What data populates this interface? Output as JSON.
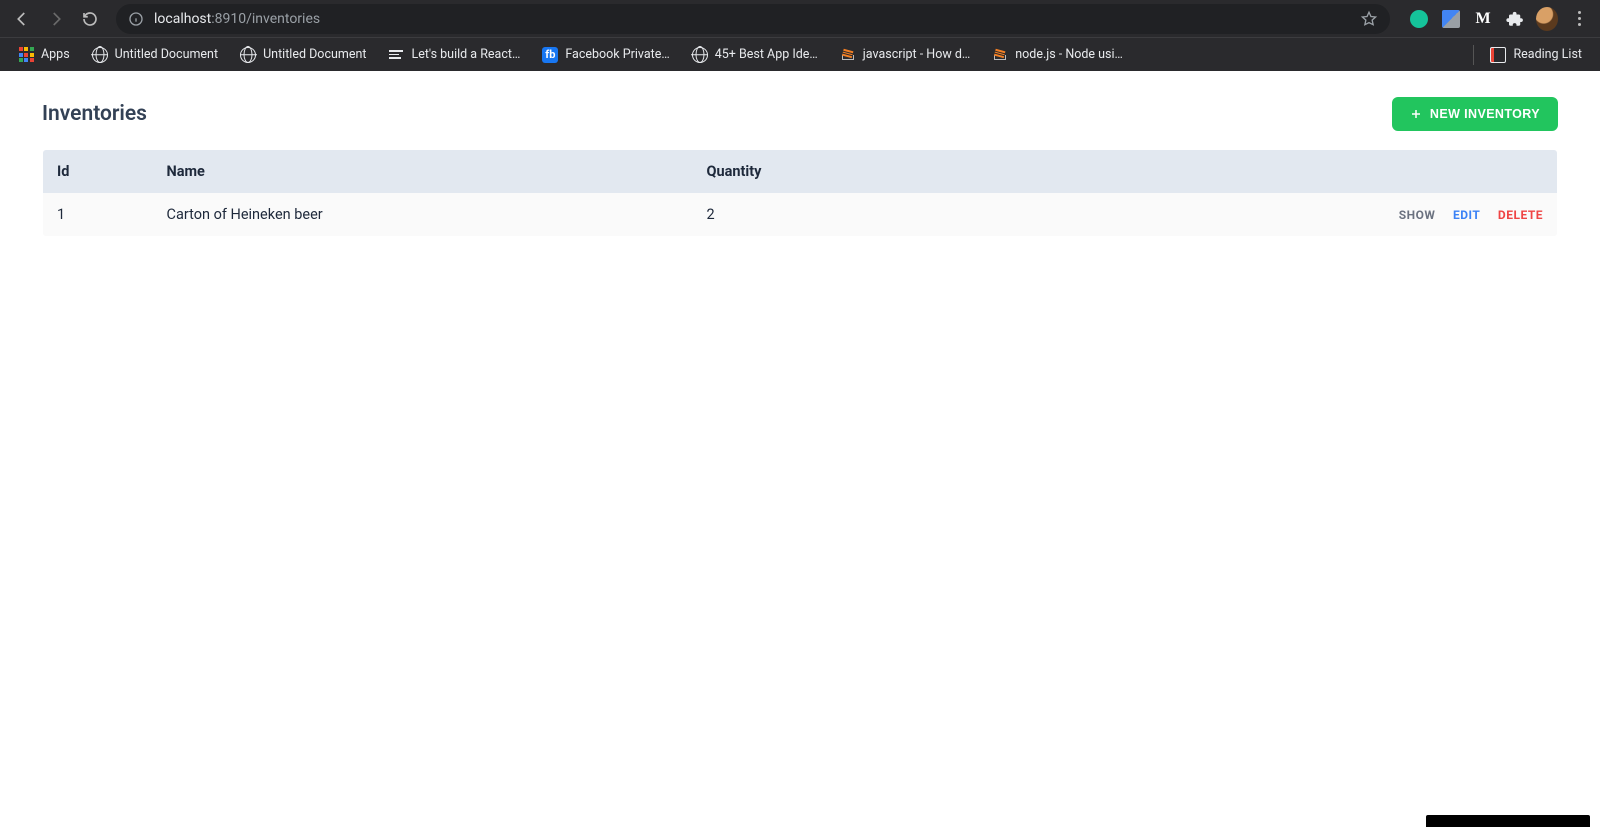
{
  "browser": {
    "url_host": "localhost",
    "url_rest": ":8910/inventories",
    "bookmarks": {
      "apps": "Apps",
      "untitled1": "Untitled Document",
      "untitled2": "Untitled Document",
      "react": "Let's build a React…",
      "facebook": "Facebook Private…",
      "appideas": "45+ Best App Ide…",
      "js": "javascript - How d…",
      "node": "node.js - Node usi…",
      "reading": "Reading List"
    }
  },
  "page": {
    "title": "Inventories",
    "new_button": "NEW INVENTORY",
    "columns": {
      "id": "Id",
      "name": "Name",
      "quantity": "Quantity"
    },
    "actions": {
      "show": "SHOW",
      "edit": "EDIT",
      "delete": "DELETE"
    },
    "rows": [
      {
        "id": "1",
        "name": "Carton of Heineken beer",
        "quantity": "2"
      }
    ]
  }
}
